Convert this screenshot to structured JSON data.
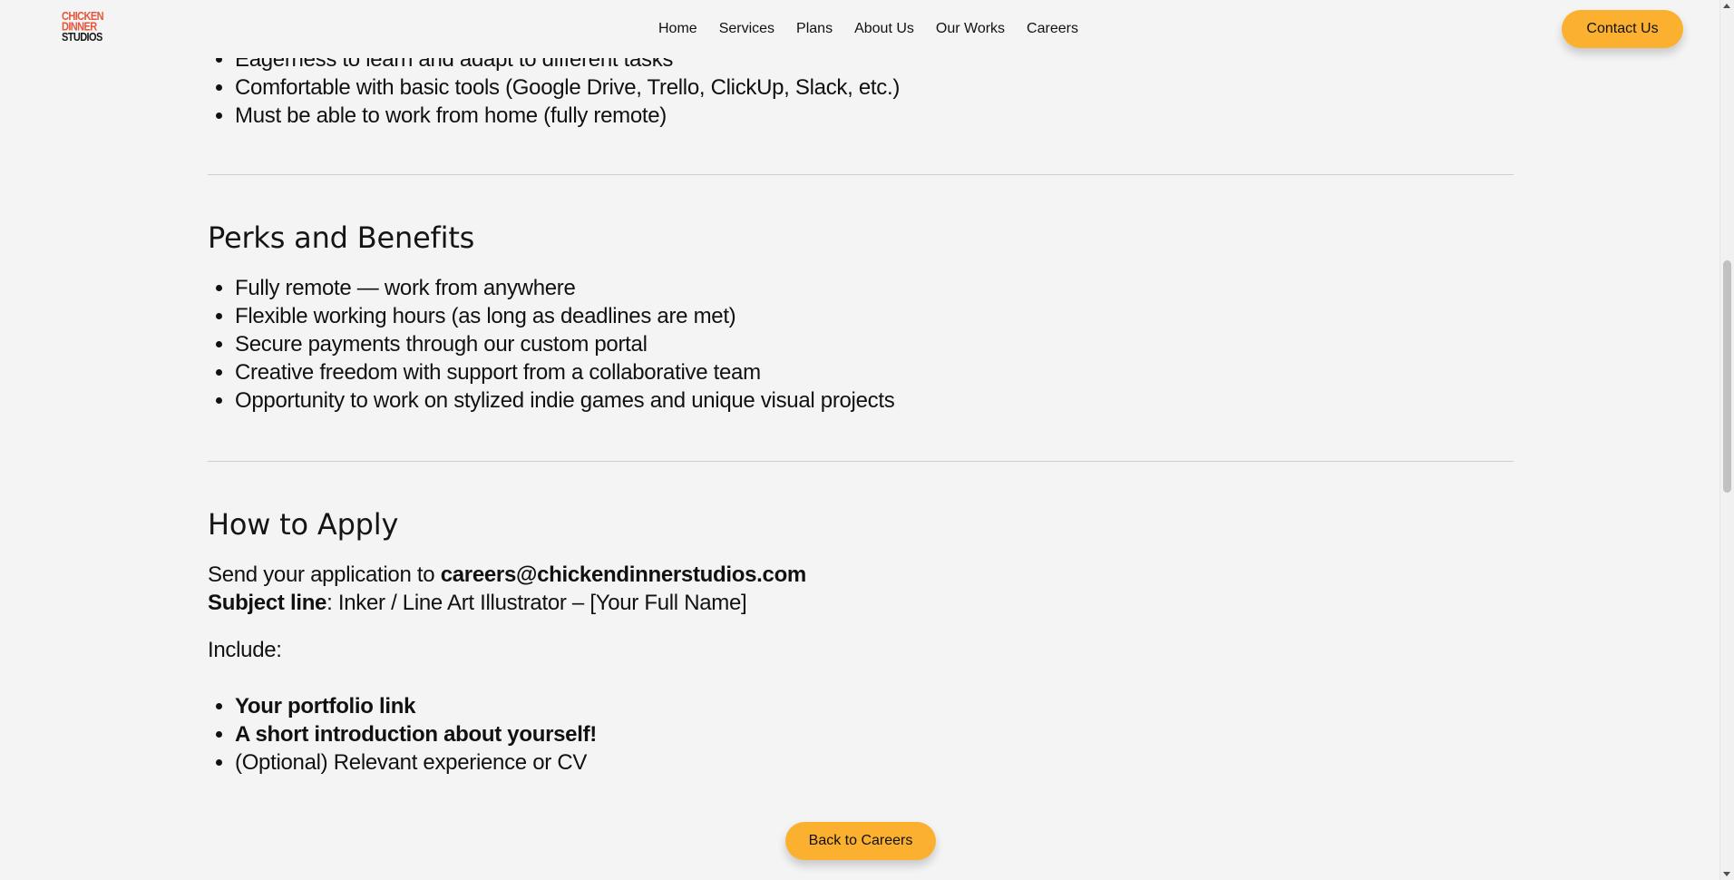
{
  "header": {
    "logo": {
      "line1": "CHICKEN",
      "line2": "DINNER",
      "line3": "STUDIOS"
    },
    "nav": [
      "Home",
      "Services",
      "Plans",
      "About Us",
      "Our Works",
      "Careers"
    ],
    "contact_label": "Contact Us"
  },
  "requirements": {
    "items": [
      "Eagerness to learn and adapt to different tasks",
      "Comfortable with basic tools (Google Drive, Trello, ClickUp, Slack, etc.)",
      "Must be able to work from home (fully remote)"
    ]
  },
  "perks": {
    "title": "Perks and Benefits",
    "items": [
      "Fully remote — work from anywhere",
      "Flexible working hours (as long as deadlines are met)",
      "Secure payments through our custom portal",
      "Creative freedom with support from a collaborative team",
      "Opportunity to work on stylized indie games and unique visual projects"
    ]
  },
  "apply": {
    "title": "How to Apply",
    "send_prefix": "Send your application to ",
    "email": "careers@chickendinnerstudios.com",
    "subject_label": "Subject line",
    "subject_value": ": Inker / Line Art Illustrator – [Your Full Name]",
    "include_label": "Include:",
    "include_items": [
      "Your portfolio link",
      "A short introduction about yourself!",
      "(Optional) Relevant experience or CV"
    ]
  },
  "back_label": "Back to Careers",
  "colors": {
    "accent": "#fbb02f",
    "logo_red": "#e8553a",
    "background": "#f4f4f4"
  }
}
